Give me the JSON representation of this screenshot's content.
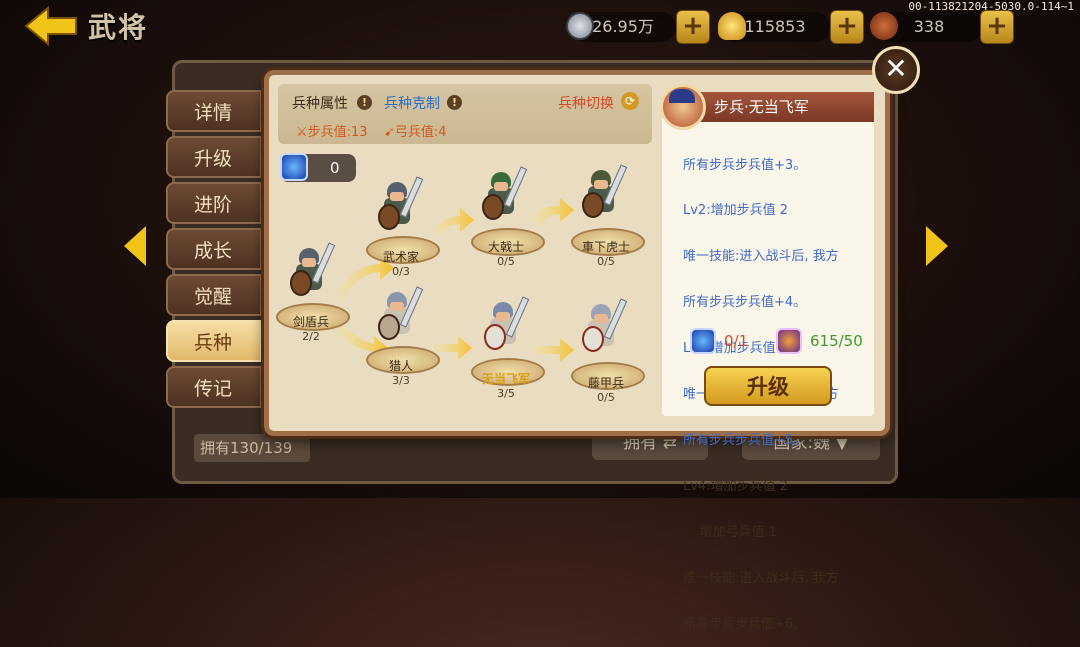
{
  "header": {
    "title": "武将",
    "version": "00-113821204-5030.0-114~1",
    "resources": [
      {
        "name": "silver",
        "value": "26.95万",
        "icon": "coin-icon"
      },
      {
        "name": "gold",
        "value": "115853",
        "icon": "gold-ingot-icon"
      },
      {
        "name": "stamina",
        "value": "338",
        "icon": "meat-icon"
      }
    ]
  },
  "tabs": [
    {
      "label": "详情"
    },
    {
      "label": "升级"
    },
    {
      "label": "进阶"
    },
    {
      "label": "成长"
    },
    {
      "label": "觉醒"
    },
    {
      "label": "兵种",
      "active": true
    },
    {
      "label": "传记"
    }
  ],
  "background_panel": {
    "own_count": "拥有130/139",
    "own_button": "拥有",
    "country_button": "国家:魏"
  },
  "dialog": {
    "attr_label": "兵种属性",
    "counter_label": "兵种克制",
    "switch_label": "兵种切换",
    "infantry_value": "步兵值:13",
    "archer_value": "弓兵值:4",
    "token_count": "0",
    "tree": [
      {
        "name": "剑盾兵",
        "count": "2/2"
      },
      {
        "name": "武术家",
        "count": "0/3"
      },
      {
        "name": "猎人",
        "count": "3/3"
      },
      {
        "name": "大戟士",
        "count": "0/5"
      },
      {
        "name": "无当飞军",
        "count": "3/5",
        "selected": true
      },
      {
        "name": "車下虎士",
        "count": "0/5"
      },
      {
        "name": "藤甲兵",
        "count": "0/5"
      }
    ],
    "detail": {
      "title": "步兵·无当飞军",
      "lines": [
        {
          "text": "所有步兵步兵值+3。",
          "color": "blue"
        },
        {
          "text": "Lv2:增加步兵值 2",
          "color": "blue"
        },
        {
          "text": "唯一技能:进入战斗后, 我方",
          "color": "blue"
        },
        {
          "text": "所有步兵步兵值+4。",
          "color": "blue"
        },
        {
          "text": "Lv3:增加步兵值 2",
          "color": "blue"
        },
        {
          "text": "唯一技能:进入战斗后, 我方",
          "color": "blue"
        },
        {
          "text": "所有步兵步兵值+5。",
          "color": "blue"
        },
        {
          "text": "Lv4:增加步兵值 2",
          "color": "dark"
        },
        {
          "text": "    增加弓兵值 1",
          "color": "dark"
        },
        {
          "text": "唯一技能:进入战斗后, 我方",
          "color": "dark"
        },
        {
          "text": "所有步兵步兵值+6。",
          "color": "dark"
        }
      ],
      "cost1": "0/1",
      "cost2": "615/50",
      "upgrade_label": "升级"
    }
  },
  "colors": {
    "accent_gold": "#f1c417",
    "blue_text": "#3f6bc6",
    "red_text": "#d34a2a",
    "green_text": "#3a9a2a"
  }
}
